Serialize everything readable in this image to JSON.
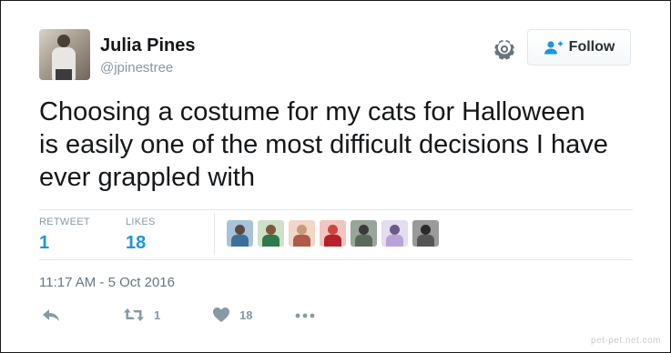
{
  "user": {
    "name": "Julia Pines",
    "handle": "@jpinestree"
  },
  "header": {
    "follow_label": "Follow",
    "settings_icon": "gear-icon",
    "follow_icon": "add-user-icon"
  },
  "tweet": {
    "text": "Choosing a costume for my cats for Halloween\nis easily one of the most difficult decisions I have\never grappled with"
  },
  "stats": {
    "retweets_label": "RETWEET",
    "retweets_count": "1",
    "likes_label": "LIKES",
    "likes_count": "18"
  },
  "likers": [
    {
      "head": "#5b4a3e",
      "body": "#3d6f9a",
      "bg": "#a9c3d6"
    },
    {
      "head": "#7a5a3a",
      "body": "#2e7a4a",
      "bg": "#cfe0c8"
    },
    {
      "head": "#c99a7a",
      "body": "#b05a4a",
      "bg": "#f0d7c8"
    },
    {
      "head": "#d0453b",
      "body": "#b81f2b",
      "bg": "#f2c6c0"
    },
    {
      "head": "#3a3a3a",
      "body": "#5a6a5a",
      "bg": "#9aa59a"
    },
    {
      "head": "#6a5a8a",
      "body": "#b9a3d6",
      "bg": "#e4dcf0"
    },
    {
      "head": "#2a2a2a",
      "body": "#555555",
      "bg": "#9a9a9a"
    }
  ],
  "timestamp": "11:17 AM - 5 Oct 2016",
  "actions": {
    "reply_icon": "reply-icon",
    "retweet_icon": "retweet-icon",
    "retweet_count": "1",
    "like_icon": "heart-icon",
    "like_count": "18",
    "more_icon": "more-dots-icon"
  },
  "watermark": "pet-pet.net.com",
  "colors": {
    "accent": "#1b95e0",
    "muted": "#8899a6",
    "text": "#14171a"
  }
}
